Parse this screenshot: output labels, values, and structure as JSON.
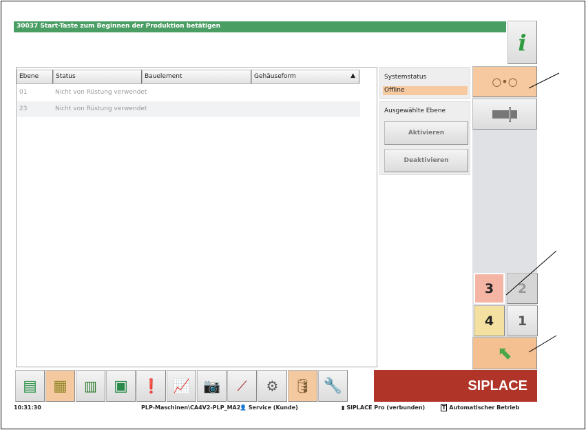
{
  "message": "30037 Start-Taste zum Beginnen der Produktion betätigen",
  "table": {
    "columns": [
      "Ebene",
      "Status",
      "Bauelement",
      "Gehäuseform"
    ],
    "rows": [
      {
        "ebene": "01",
        "status": "Nicht von Rüstung verwendet"
      },
      {
        "ebene": "23",
        "status": "Nicht von Rüstung verwendet"
      }
    ]
  },
  "systemstatus": {
    "label": "Systemstatus",
    "value": "Offline"
  },
  "selected_level": {
    "label": "Ausgewählte Ebene",
    "activate": "Aktivieren",
    "deactivate": "Deaktivieren"
  },
  "levels": [
    "3",
    "2",
    "4",
    "1"
  ],
  "brand": "SIPLACE",
  "statusbar": {
    "time": "10:31:30",
    "machine": "PLP-Maschinen\\CA4V2-PLP_MA2",
    "user": "Service (Kunde)",
    "connection": "SIPLACE Pro (verbunden)",
    "mode": "Automatischer Betrieb"
  }
}
